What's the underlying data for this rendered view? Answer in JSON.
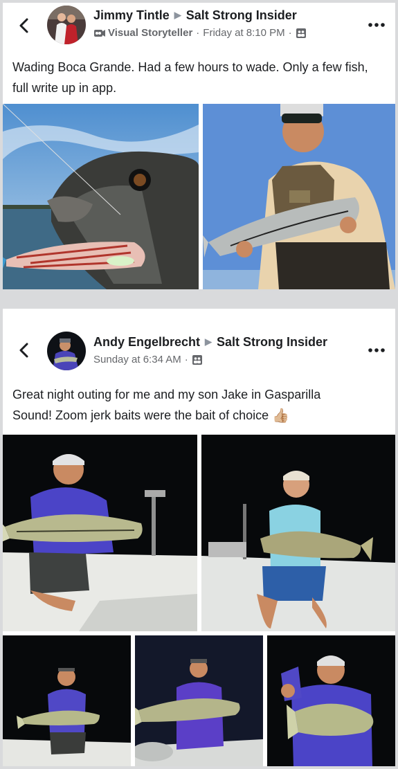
{
  "posts": [
    {
      "author": "Jimmy Tintle",
      "group": "Salt Strong Insider",
      "badge": "Visual Storyteller",
      "time": "Friday at 8:10 PM",
      "text": "Wading Boca Grande. Had a few hours to wade. Only a few fish, full write up in app."
    },
    {
      "author": "Andy Engelbrecht",
      "group": "Salt Strong Insider",
      "time": "Sunday at 6:34 AM",
      "text_line1": "Great night outing for me and my son Jake in Gasparilla",
      "text_line2": "Sound! Zoom jerk baits were the bait of choice",
      "emoji": "👍🏼"
    }
  ],
  "colors": {
    "background": "#d9dadc",
    "card": "#ffffff",
    "name": "#1c1e21",
    "meta": "#65676b"
  }
}
